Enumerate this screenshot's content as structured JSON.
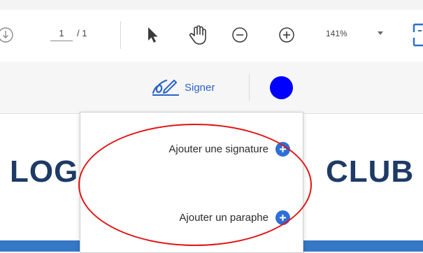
{
  "toolbar": {
    "page_current": "1",
    "page_total": "/ 1",
    "zoom": "141%",
    "icons": [
      "download-icon",
      "select-arrow-icon",
      "hand-tool-icon",
      "zoom-out-icon",
      "zoom-in-icon",
      "chevron-down-icon",
      "fit-page-icon"
    ]
  },
  "sign_bar": {
    "signer_label": "Signer",
    "ink_color": "#0000ff"
  },
  "menu": {
    "items": [
      {
        "label": "Ajouter une signature"
      },
      {
        "label": "Ajouter un paraphe"
      }
    ]
  },
  "document": {
    "title_left": "LOG",
    "title_right": "CLUB"
  },
  "colors": {
    "accent": "#2d6fd6",
    "annotation_ellipse": "#e21515",
    "title": "#1e3a66"
  }
}
